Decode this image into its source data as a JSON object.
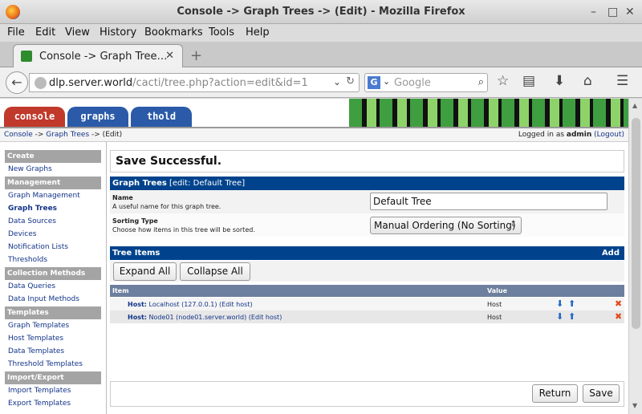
{
  "window": {
    "title": "Console -> Graph Trees -> (Edit) - Mozilla Firefox",
    "controls": [
      "–",
      "□",
      "✕"
    ]
  },
  "menu": [
    "File",
    "Edit",
    "View",
    "History",
    "Bookmarks",
    "Tools",
    "Help"
  ],
  "tab": {
    "label": "Console -> Graph Tree…",
    "close": "✕",
    "new": "+"
  },
  "url": {
    "host": "dlp.server.world",
    "path": "/cacti/tree.php?action=edit&id=1"
  },
  "search": {
    "engine_letter": "G",
    "placeholder": "Google"
  },
  "toolbar_icons": [
    "star-icon",
    "reading-list-icon",
    "download-icon",
    "home-icon",
    "menu-icon"
  ],
  "cacti_tabs": [
    {
      "label": "console",
      "color": "#c0392b"
    },
    {
      "label": "graphs",
      "color": "#2b5aa8"
    },
    {
      "label": "thold",
      "color": "#2b5aa8"
    }
  ],
  "breadcrumb": {
    "console": "Console",
    "sep1": " -> ",
    "graph_trees": "Graph Trees",
    "rest": " -> (Edit)"
  },
  "login": {
    "prefix": "Logged in as ",
    "user": "admin",
    "logout": "(Logout)"
  },
  "sidebar": [
    {
      "type": "header",
      "label": "Create"
    },
    {
      "type": "item",
      "label": "New Graphs"
    },
    {
      "type": "header",
      "label": "Management"
    },
    {
      "type": "item",
      "label": "Graph Management"
    },
    {
      "type": "item",
      "label": "Graph Trees",
      "active": true
    },
    {
      "type": "item",
      "label": "Data Sources"
    },
    {
      "type": "item",
      "label": "Devices"
    },
    {
      "type": "item",
      "label": "Notification Lists"
    },
    {
      "type": "item",
      "label": "Thresholds"
    },
    {
      "type": "header",
      "label": "Collection Methods"
    },
    {
      "type": "item",
      "label": "Data Queries"
    },
    {
      "type": "item",
      "label": "Data Input Methods"
    },
    {
      "type": "header",
      "label": "Templates"
    },
    {
      "type": "item",
      "label": "Graph Templates"
    },
    {
      "type": "item",
      "label": "Host Templates"
    },
    {
      "type": "item",
      "label": "Data Templates"
    },
    {
      "type": "item",
      "label": "Threshold Templates"
    },
    {
      "type": "header",
      "label": "Import/Export"
    },
    {
      "type": "item",
      "label": "Import Templates"
    },
    {
      "type": "item",
      "label": "Export Templates"
    }
  ],
  "save_message": "Save Successful.",
  "graph_trees": {
    "header": "Graph Trees",
    "subheader": " [edit: Default Tree]",
    "name_label": "Name",
    "name_desc": "A useful name for this graph tree.",
    "name_value": "Default Tree",
    "sort_label": "Sorting Type",
    "sort_desc": "Choose how items in this tree will be sorted.",
    "sort_value": "Manual Ordering (No Sorting)"
  },
  "tree_items": {
    "header": "Tree Items",
    "add": "Add",
    "expand_all": "Expand All",
    "collapse_all": "Collapse All",
    "col_item": "Item",
    "col_value": "Value",
    "rows": [
      {
        "host_label": "Host:",
        "text": " Localhost (127.0.0.1) (Edit host)",
        "value": "Host"
      },
      {
        "host_label": "Host:",
        "text": " Node01 (node01.server.world) (Edit host)",
        "value": "Host"
      }
    ]
  },
  "buttons": {
    "return": "Return",
    "save": "Save"
  }
}
